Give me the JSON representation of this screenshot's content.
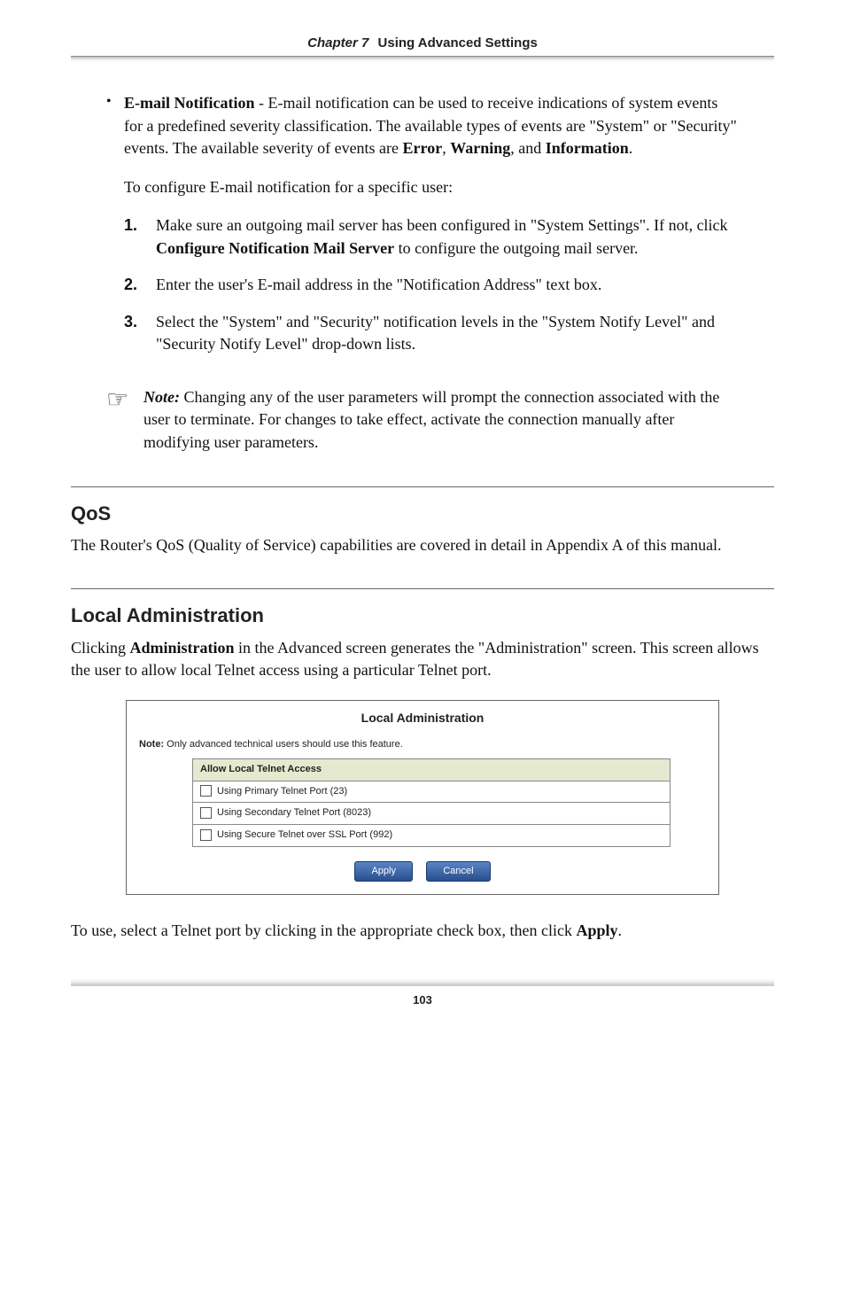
{
  "header": {
    "chapter_label": "Chapter 7",
    "chapter_title": "Using Advanced Settings"
  },
  "email_section": {
    "label_prefix": "E-mail Notification",
    "text_after_label": " - E-mail notification can be used to receive indications of system events for a predefined severity classification. The available types of events are \"System\" or \"Security\" events. The available severity of events are ",
    "bold1": "Error",
    "sep1": ", ",
    "bold2": "Warning",
    "sep2": ", and ",
    "bold3": "Information",
    "tail": ".",
    "config_line": "To configure E-mail notification for a specific user:",
    "steps": {
      "s1a": "Make sure an outgoing mail server has been configured in \"System Settings\". If not, click ",
      "s1b": "Configure Notification Mail Server",
      "s1c": " to configure the outgoing mail server.",
      "s2": "Enter the user's E-mail address in the \"Notification Address\" text box.",
      "s3": "Select the \"System\" and \"Security\" notification levels in the \"System Notify Level\" and \"Security Notify Level\" drop-down lists."
    },
    "step_nums": {
      "n1": "1.",
      "n2": "2.",
      "n3": "3."
    }
  },
  "note": {
    "label": "Note:",
    "text": " Changing any of the user parameters will prompt the connection associated with the user to terminate. For changes to take effect, activate the connection manually after modifying user parameters."
  },
  "qos": {
    "heading": "QoS",
    "para": "The Router's QoS (Quality of Service) capabilities are covered in detail in Appendix A of this manual."
  },
  "local_admin": {
    "heading": "Local Administration",
    "para_a": "Clicking ",
    "para_b": "Administration",
    "para_c": " in the Advanced screen generates the \"Administration\" screen. This screen allows the user to allow local Telnet access using a particular Telnet port.",
    "panel": {
      "title": "Local Administration",
      "note_label": "Note:",
      "note_text": " Only advanced technical users should use this feature.",
      "col_header": "Allow Local Telnet Access",
      "rows": [
        "Using Primary Telnet Port (23)",
        "Using Secondary Telnet Port (8023)",
        "Using Secure Telnet over SSL Port (992)"
      ],
      "apply": "Apply",
      "cancel": "Cancel"
    },
    "closing_a": "To use, select a Telnet port by clicking in the appropriate check box, then click ",
    "closing_b": "Apply",
    "closing_c": "."
  },
  "page_number": "103"
}
